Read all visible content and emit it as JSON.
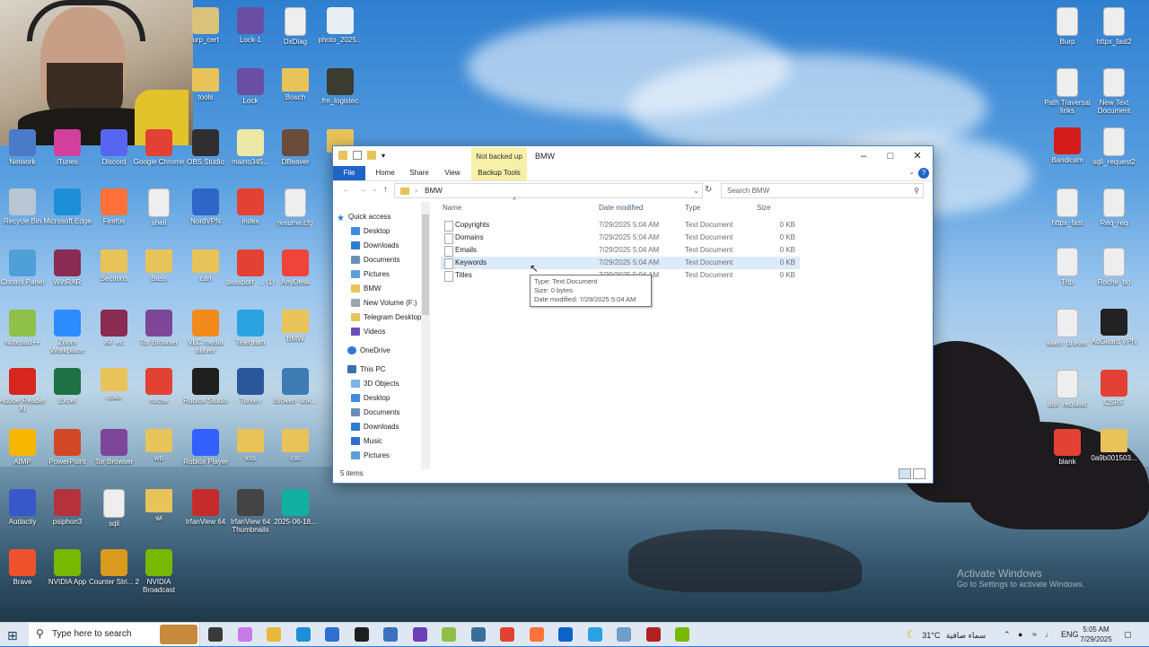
{
  "desktop_icons": [
    {
      "label": "urp_cert",
      "icon": "certificate-icon",
      "color": "#d9c27a"
    },
    {
      "label": "Lock-1",
      "icon": "h-file-icon",
      "color": "#6a4ea3"
    },
    {
      "label": "DxDiag",
      "icon": "text-doc-icon",
      "color": "#eeeeee"
    },
    {
      "label": "photo_2025...",
      "icon": "image-icon",
      "color": "#e8eef3"
    },
    {
      "label": "tools",
      "icon": "folder-icon",
      "color": "#e8c35a"
    },
    {
      "label": "Lock",
      "icon": "h-file-icon",
      "color": "#6a4ea3"
    },
    {
      "label": "Bosch",
      "icon": "folder-icon",
      "color": "#e8c35a"
    },
    {
      "label": "fm_logistec",
      "icon": "archive-icon",
      "color": "#3b3b2f"
    },
    {
      "label": "Network",
      "icon": "network-icon",
      "color": "#4b7bc8"
    },
    {
      "label": "iTunes",
      "icon": "itunes-icon",
      "color": "#d23f9c"
    },
    {
      "label": "Discord",
      "icon": "discord-icon",
      "color": "#5865f2"
    },
    {
      "label": "Google Chrome",
      "icon": "chrome-icon",
      "color": "#e34133"
    },
    {
      "label": "OBS Studio",
      "icon": "obs-icon",
      "color": "#302e31"
    },
    {
      "label": "malno345...",
      "icon": "script-icon",
      "color": "#ece9a8"
    },
    {
      "label": "DBeaver",
      "icon": "dbeaver-icon",
      "color": "#6b4b3a"
    },
    {
      "label": "Lea...",
      "icon": "folder-icon",
      "color": "#e8c35a"
    },
    {
      "label": "Recycle Bin",
      "icon": "recycle-bin-icon",
      "color": "#b8c6d3"
    },
    {
      "label": "Microsoft Edge",
      "icon": "edge-icon",
      "color": "#1e8fd6"
    },
    {
      "label": "Firefox",
      "icon": "firefox-icon",
      "color": "#ff7139"
    },
    {
      "label": "shell",
      "icon": "text-doc-icon",
      "color": "#eeeeee"
    },
    {
      "label": "NordVPN",
      "icon": "nordvpn-icon",
      "color": "#2f66c8"
    },
    {
      "label": "index",
      "icon": "chrome-icon",
      "color": "#e34133"
    },
    {
      "label": "resume.cfg",
      "icon": "text-doc-icon",
      "color": "#eeeeee"
    },
    {
      "label": "Control Panel",
      "icon": "control-panel-icon",
      "color": "#4fa0d8"
    },
    {
      "label": "WinRAR",
      "icon": "winrar-icon",
      "color": "#8a2b52"
    },
    {
      "label": "Sections",
      "icon": "folder-icon",
      "color": "#e8c35a"
    },
    {
      "label": "Bass",
      "icon": "folder-icon",
      "color": "#e8c35a"
    },
    {
      "label": "carl",
      "icon": "folder-icon",
      "color": "#e8c35a"
    },
    {
      "label": "passport_... (1)",
      "icon": "chrome-icon",
      "color": "#e34133"
    },
    {
      "label": "AnyDesk",
      "icon": "anydesk-icon",
      "color": "#ef443b"
    },
    {
      "label": "Notepad++",
      "icon": "notepad-icon",
      "color": "#8ec04a"
    },
    {
      "label": "Zoom Workplace",
      "icon": "zoom-icon",
      "color": "#2d8cff"
    },
    {
      "label": "All_ec",
      "icon": "winrar-icon",
      "color": "#8a2b52"
    },
    {
      "label": "Tor Browser",
      "icon": "tor-icon",
      "color": "#7d4698"
    },
    {
      "label": "VLC media player",
      "icon": "vlc-icon",
      "color": "#f28b1c"
    },
    {
      "label": "Telegram",
      "icon": "telegram-icon",
      "color": "#2aa3e0"
    },
    {
      "label": "BMW",
      "icon": "folder-icon",
      "color": "#e8c35a"
    },
    {
      "label": "Adobe Reader XI",
      "icon": "adobe-icon",
      "color": "#d7261e"
    },
    {
      "label": "Excel",
      "icon": "excel-icon",
      "color": "#1e7145"
    },
    {
      "label": "coke",
      "icon": "folder-icon",
      "color": "#e8c35a"
    },
    {
      "label": "roche",
      "icon": "chrome-icon",
      "color": "#e34133"
    },
    {
      "label": "Roblox Studio",
      "icon": "roblox-icon",
      "color": "#1f1f1f"
    },
    {
      "label": "Turkey",
      "icon": "word-icon",
      "color": "#2b579a"
    },
    {
      "label": "Broken_link...",
      "icon": "python-icon",
      "color": "#3e7bb3"
    },
    {
      "label": "AIMP",
      "icon": "aimp-icon",
      "color": "#f6b500"
    },
    {
      "label": "PowerPoint",
      "icon": "powerpoint-icon",
      "color": "#d24726"
    },
    {
      "label": "Tor Browser",
      "icon": "tor-icon",
      "color": "#7d4698"
    },
    {
      "label": "wb",
      "icon": "folder-icon",
      "color": "#e8c35a"
    },
    {
      "label": "Roblox Player",
      "icon": "roblox-player-icon",
      "color": "#335fff"
    },
    {
      "label": "xss",
      "icon": "folder-icon",
      "color": "#e8c35a"
    },
    {
      "label": "cat",
      "icon": "folder-icon",
      "color": "#e8c35a"
    },
    {
      "label": "Audacity",
      "icon": "audacity-icon",
      "color": "#3857c8"
    },
    {
      "label": "psiphon3",
      "icon": "psiphon-icon",
      "color": "#b5313b"
    },
    {
      "label": "sqli",
      "icon": "text-doc-icon",
      "color": "#eeeeee"
    },
    {
      "label": "wl",
      "icon": "folder-icon",
      "color": "#e8c35a"
    },
    {
      "label": "IrfanView 64",
      "icon": "irfanview-icon",
      "color": "#c52b2b"
    },
    {
      "label": "IrfanView 64 Thumbnails",
      "icon": "panda-icon",
      "color": "#444444"
    },
    {
      "label": "2025-06-18...",
      "icon": "lightning-icon",
      "color": "#12b0a1"
    },
    {
      "label": "Brave",
      "icon": "brave-icon",
      "color": "#f0522d"
    },
    {
      "label": "NVIDIA App",
      "icon": "nvidia-icon",
      "color": "#76b900"
    },
    {
      "label": "Counter Stri... 2",
      "icon": "cs2-icon",
      "color": "#d99a1e"
    },
    {
      "label": "NVIDIA Broadcast",
      "icon": "nvidia-icon",
      "color": "#76b900"
    },
    {
      "label": "Burp",
      "icon": "text-doc-icon",
      "color": "#eeeeee"
    },
    {
      "label": "httpx_fast2",
      "icon": "text-doc-icon",
      "color": "#eeeeee"
    },
    {
      "label": "Path Traversal links",
      "icon": "text-doc-icon",
      "color": "#eeeeee"
    },
    {
      "label": "New Text Document",
      "icon": "text-doc-icon",
      "color": "#eeeeee"
    },
    {
      "label": "Bandicam",
      "icon": "bandicam-icon",
      "color": "#d51c1c"
    },
    {
      "label": "sqli_request2",
      "icon": "text-doc-icon",
      "color": "#eeeeee"
    },
    {
      "label": "httpx_fast",
      "icon": "text-doc-icon",
      "color": "#eeeeee"
    },
    {
      "label": "Req_req",
      "icon": "text-doc-icon",
      "color": "#eeeeee"
    },
    {
      "label": "Trip",
      "icon": "text-doc-icon",
      "color": "#eeeeee"
    },
    {
      "label": "Roche_bg",
      "icon": "text-doc-icon",
      "color": "#eeeeee"
    },
    {
      "label": "keen_pl.ever",
      "icon": "text-doc-icon",
      "color": "#eeeeee"
    },
    {
      "label": "AdGuard VPN",
      "icon": "adguard-icon",
      "color": "#222222"
    },
    {
      "label": "sqli_request",
      "icon": "text-doc-icon",
      "color": "#eeeeee"
    },
    {
      "label": "CSRF",
      "icon": "chrome-icon",
      "color": "#e34133"
    },
    {
      "label": "blank",
      "icon": "chrome-icon",
      "color": "#e34133"
    },
    {
      "label": "0a9b001503...",
      "icon": "folder-icon",
      "color": "#e8c35a"
    }
  ],
  "explorer": {
    "title": "BMW",
    "context_tab": "Not backed up",
    "ribbon_tabs": [
      "File",
      "Home",
      "Share",
      "View",
      "Backup Tools"
    ],
    "address": "BMW",
    "search_placeholder": "Search BMW",
    "nav": {
      "quick_access": "Quick access",
      "quick_items": [
        {
          "label": "Desktop",
          "icon": "desktop-icon",
          "color": "#3d8be0",
          "pinned": true
        },
        {
          "label": "Downloads",
          "icon": "download-icon",
          "color": "#2b7cd3",
          "pinned": true
        },
        {
          "label": "Documents",
          "icon": "documents-icon",
          "color": "#6b8fb8",
          "pinned": true
        },
        {
          "label": "Pictures",
          "icon": "pictures-icon",
          "color": "#5aa0d8",
          "pinned": true
        },
        {
          "label": "BMW",
          "icon": "folder-icon",
          "color": "#e8c35a",
          "pinned": false
        },
        {
          "label": "New Volume (F:)",
          "icon": "drive-icon",
          "color": "#9aa5b1",
          "pinned": false
        },
        {
          "label": "Telegram Desktop",
          "icon": "folder-icon",
          "color": "#e8c35a",
          "pinned": false
        },
        {
          "label": "Videos",
          "icon": "videos-icon",
          "color": "#6b4fb8",
          "pinned": false
        }
      ],
      "onedrive": "OneDrive",
      "this_pc": "This PC",
      "pc_items": [
        {
          "label": "3D Objects",
          "icon": "3d-objects-icon",
          "color": "#7ab3e8"
        },
        {
          "label": "Desktop",
          "icon": "desktop-icon",
          "color": "#3d8be0"
        },
        {
          "label": "Documents",
          "icon": "documents-icon",
          "color": "#6b8fb8"
        },
        {
          "label": "Downloads",
          "icon": "download-icon",
          "color": "#2b7cd3"
        },
        {
          "label": "Music",
          "icon": "music-icon",
          "color": "#2e6fd0"
        },
        {
          "label": "Pictures",
          "icon": "pictures-icon",
          "color": "#5aa0d8"
        }
      ]
    },
    "columns": {
      "name": "Name",
      "date": "Date modified",
      "type": "Type",
      "size": "Size"
    },
    "files": [
      {
        "name": "Copyrights",
        "date": "7/29/2025 5:04 AM",
        "type": "Text Document",
        "size": "0 KB"
      },
      {
        "name": "Domains",
        "date": "7/29/2025 5:04 AM",
        "type": "Text Document",
        "size": "0 KB"
      },
      {
        "name": "Emails",
        "date": "7/29/2025 5:04 AM",
        "type": "Text Document",
        "size": "0 KB"
      },
      {
        "name": "Keywords",
        "date": "7/29/2025 5:04 AM",
        "type": "Text Document",
        "size": "0 KB"
      },
      {
        "name": "Titles",
        "date": "7/29/2025 5:04 AM",
        "type": "Text Document",
        "size": "0 KB"
      }
    ],
    "hovered_index": 3,
    "tooltip": {
      "type": "Type: Text Document",
      "size": "Size: 0 bytes",
      "date": "Date modified: 7/29/2025 5:04 AM"
    },
    "status": "5 items"
  },
  "watermark": {
    "line1": "Activate Windows",
    "line2": "Go to Settings to activate Windows."
  },
  "taskbar": {
    "search_placeholder": "Type here to search",
    "apps": [
      {
        "icon": "task-view-icon",
        "color": "#3a3a3a"
      },
      {
        "icon": "copilot-icon",
        "color": "#c77ae8"
      },
      {
        "icon": "file-explorer-icon",
        "color": "#e8b93a"
      },
      {
        "icon": "edge-icon",
        "color": "#1e8fd6"
      },
      {
        "icon": "store-icon",
        "color": "#2f6fd0"
      },
      {
        "icon": "terminal-icon",
        "color": "#1f1f1f"
      },
      {
        "icon": "app-icon",
        "color": "#3d6fc0"
      },
      {
        "icon": "vs-icon",
        "color": "#6b3fb8"
      },
      {
        "icon": "app-icon",
        "color": "#8fbf4a"
      },
      {
        "icon": "app-icon",
        "color": "#3b6f9a"
      },
      {
        "icon": "chrome-icon",
        "color": "#e34133"
      },
      {
        "icon": "firefox-icon",
        "color": "#ff7139"
      },
      {
        "icon": "outlook-icon",
        "color": "#0a64c8"
      },
      {
        "icon": "telegram-icon",
        "color": "#2aa3e0"
      },
      {
        "icon": "notepad-icon",
        "color": "#6f9ec8"
      },
      {
        "icon": "app-icon",
        "color": "#b32020"
      },
      {
        "icon": "nvidia-icon",
        "color": "#76b900"
      }
    ],
    "weather": "31°C",
    "weather_text": "سماء صافية",
    "lang": "ENG",
    "time": "5:05 AM",
    "date": "7/29/2025"
  }
}
